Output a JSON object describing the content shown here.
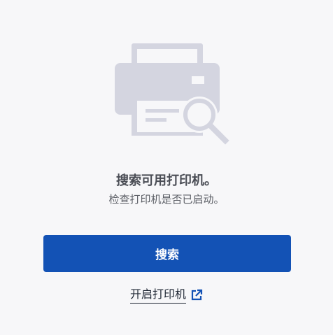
{
  "message": {
    "title": "搜索可用打印机。",
    "subtitle": "检查打印机是否已启动。"
  },
  "actions": {
    "search_label": "搜索",
    "open_printer_label": "开启打印机"
  },
  "icons": {
    "illustration": "printer-search-icon",
    "link": "external-link-icon"
  },
  "colors": {
    "primary": "#1352b5",
    "illustration": "#d4d5e0",
    "background": "#f7f7f9"
  }
}
